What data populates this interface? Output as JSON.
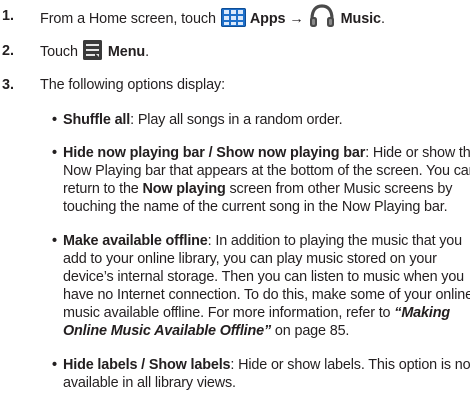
{
  "steps": [
    {
      "number": "1.",
      "prefix": "From a Home screen, touch",
      "apps_label": "Apps",
      "arrow": "→",
      "music_label": "Music",
      "period": "."
    },
    {
      "number": "2.",
      "prefix": "Touch",
      "menu_label": "Menu",
      "period": "."
    },
    {
      "number": "3.",
      "text": "The following options display:"
    }
  ],
  "icons": {
    "apps": "apps-grid-icon",
    "music": "headphones-icon",
    "menu": "menu-icon",
    "apps_color": "#1e6fc9",
    "music_color": "#404040",
    "menu_color": "#3a3a3a"
  },
  "options": [
    {
      "term": "Shuffle all",
      "lines": [
        "Play all songs in a random order."
      ]
    },
    {
      "term": "Hide now playing bar / Show now playing bar",
      "line1_rest": "Hide or show the",
      "line2": "Now Playing bar that appears at the bottom of the screen. You can",
      "line3_pre": "return to the",
      "line3_bold": "Now playing",
      "line3_post": "screen from other Music screens by",
      "line4": "touching the name of the current song in the Now Playing bar."
    },
    {
      "term": "Make available offline",
      "line1_rest": "In addition to playing the music that you",
      "line2": "add to your online library, you can play music stored on your",
      "line3": "device’s internal storage. Then you can listen to music when you",
      "line4": "have no Internet connection. To do this, make some of your online",
      "line5_pre": "music available offline. For more information, refer to",
      "line5_ref": "“Making",
      "line6_ref": "Online Music Available Offline”",
      "line6_post": " on page 85."
    },
    {
      "term": "Hide labels / Show labels",
      "line1_rest": "Hide or show labels. This option is not",
      "line2": "available in all library views."
    }
  ]
}
